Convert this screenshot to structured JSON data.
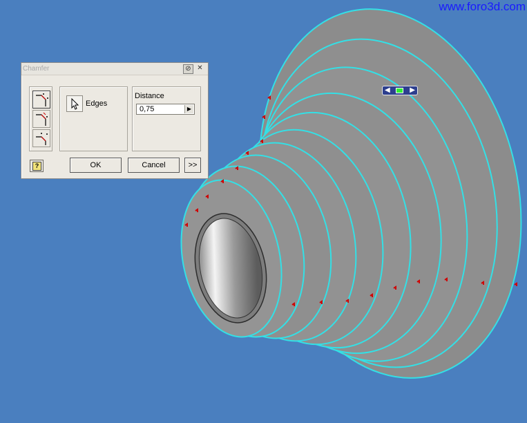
{
  "watermark": "www.foro3d.com",
  "dialog": {
    "title": "Chamfer",
    "edges_label": "Edges",
    "distance_label": "Distance",
    "distance_value": "0,75",
    "ok_label": "OK",
    "cancel_label": "Cancel",
    "more_label": ">>",
    "help_label": "?"
  },
  "colors": {
    "background": "#4a7fbf",
    "part_face": "#8f8f8f",
    "edge_highlight": "#33e0e6",
    "edge_preview": "#d00000",
    "watermark": "#1a1aff"
  },
  "icons": {
    "pin": "pin-icon",
    "close": "close-icon",
    "select": "cursor-arrow-icon",
    "help": "help-icon"
  }
}
